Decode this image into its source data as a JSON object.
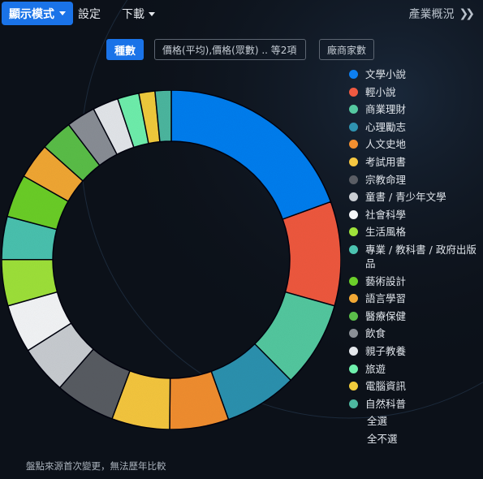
{
  "topbar": {
    "display_mode": "顯示模式",
    "settings": "設定",
    "download": "下載",
    "overview": "產業概況"
  },
  "filters": {
    "active": "種數",
    "price": "價格(平均),價格(眾數) .. 等2項",
    "vendors": "廠商家數"
  },
  "footnote": "盤點來源首次變更，無法歷年比較",
  "chart_data": {
    "type": "pie",
    "variant": "donut",
    "legend_position": "right",
    "categories": [
      "文學小說",
      "輕小說",
      "商業理財",
      "心理勵志",
      "人文史地",
      "考試用書",
      "宗教命理",
      "童書 / 青少年文學",
      "社會科學",
      "生活風格",
      "專業 / 教科書 / 政府出版品",
      "藝術設計",
      "語言學習",
      "醫療保健",
      "飲食",
      "親子教養",
      "旅遊",
      "電腦資訊",
      "自然科普"
    ],
    "values": [
      19.0,
      9.7,
      8.0,
      6.8,
      5.5,
      5.4,
      5.6,
      4.5,
      4.5,
      4.3,
      4.0,
      4.0,
      3.3,
      3.0,
      2.7,
      2.4,
      2.0,
      1.5,
      1.5
    ],
    "colors": [
      "#0d7ff0",
      "#f05a41",
      "#55c9a0",
      "#2f93b0",
      "#f28f30",
      "#f6c741",
      "#5a5d64",
      "#c9cdd2",
      "#f4f6f8",
      "#9fe23a",
      "#4cc3b0",
      "#6ccf2a",
      "#f2a835",
      "#5bbf4a",
      "#8a8f96",
      "#e4e7eb",
      "#6ff0ad",
      "#f2cc3c",
      "#4db8a0"
    ]
  },
  "legend": {
    "select_all": "全選",
    "select_none": "全不選"
  }
}
